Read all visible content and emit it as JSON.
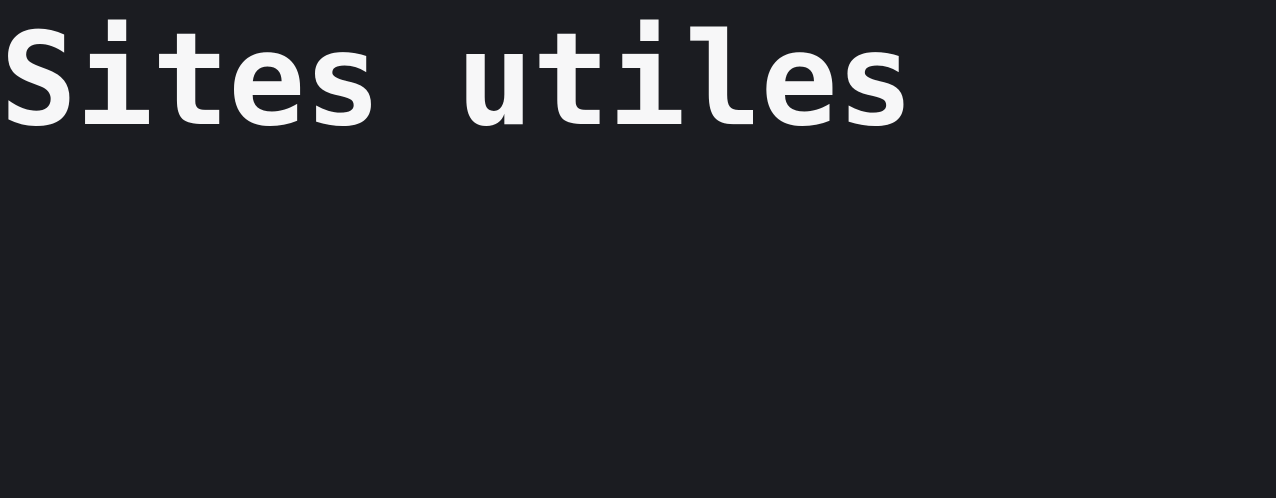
{
  "page": {
    "title": "Sites utiles"
  },
  "colors": {
    "background": "#1b1c21",
    "title_text": "#f7f7f8"
  }
}
